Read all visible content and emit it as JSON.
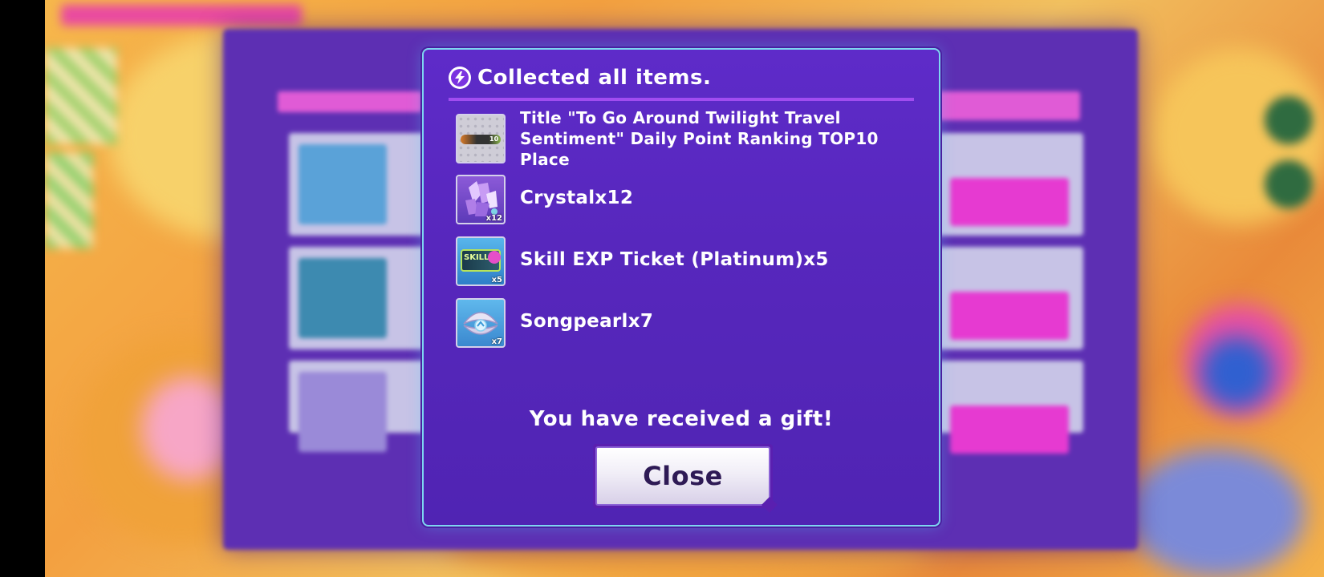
{
  "dialog": {
    "title": "Collected all items.",
    "title_icon": "lightning-bolt-icon",
    "items": [
      {
        "label": "Title \"To Go Around Twilight Travel Sentiment\" Daily Point Ranking TOP10 Place",
        "icon": "title-plate-icon",
        "badge": "10",
        "qty": ""
      },
      {
        "label": "Crystalx12",
        "icon": "crystal-icon",
        "qty": "x12"
      },
      {
        "label": "Skill EXP Ticket (Platinum)x5",
        "icon": "skill-ticket-icon",
        "ticket_text": "SKILL",
        "qty": "x5"
      },
      {
        "label": "Songpearlx7",
        "icon": "songpearl-shell-icon",
        "qty": "x7"
      }
    ],
    "message": "You have received a gift!",
    "close_label": "Close"
  },
  "colors": {
    "dialog_bg": "#5727bd",
    "dialog_border": "#7ed6f0",
    "header_rule": "#a14cf0",
    "button_text": "#2e1a55",
    "background_orange": "#f3a040"
  }
}
